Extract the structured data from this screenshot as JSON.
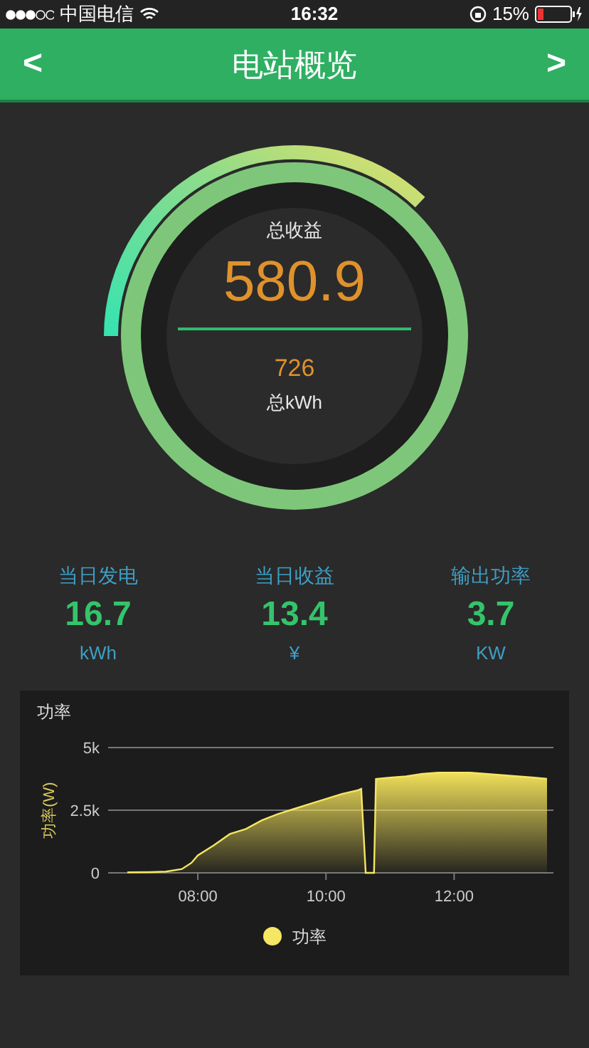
{
  "status_bar": {
    "carrier": "中国电信",
    "time": "16:32",
    "battery": "15%"
  },
  "header": {
    "back": "<",
    "title": "电站概览",
    "forward": ">"
  },
  "gauge": {
    "label": "总收益",
    "value": "580.9",
    "sub_value": "726",
    "sub_label": "总kWh"
  },
  "stats": [
    {
      "label": "当日发电",
      "value": "16.7",
      "unit": "kWh"
    },
    {
      "label": "当日收益",
      "value": "13.4",
      "unit": "¥"
    },
    {
      "label": "输出功率",
      "value": "3.7",
      "unit": "KW"
    }
  ],
  "power_chart": {
    "title": "功率",
    "chart_data": {
      "type": "area",
      "ylabel": "功率(W)",
      "x": [
        6.9,
        7.25,
        7.5,
        7.75,
        7.9,
        8.0,
        8.25,
        8.5,
        8.75,
        9.0,
        9.25,
        9.5,
        9.75,
        10.0,
        10.25,
        10.5,
        10.55,
        10.62,
        10.75,
        10.78,
        11.0,
        11.25,
        11.5,
        11.75,
        12.0,
        12.25,
        12.5,
        12.75,
        13.0,
        13.25,
        13.45
      ],
      "series": [
        {
          "name": "功率",
          "color": "#f5e663",
          "values": [
            20,
            30,
            50,
            150,
            400,
            700,
            1100,
            1550,
            1750,
            2100,
            2350,
            2550,
            2750,
            2950,
            3150,
            3300,
            3350,
            0,
            0,
            3750,
            3800,
            3850,
            3950,
            4000,
            4000,
            4000,
            3950,
            3900,
            3850,
            3800,
            3750
          ]
        }
      ],
      "xlim": [
        6.6,
        13.55
      ],
      "ylim": [
        0,
        5000
      ],
      "xticks": [
        {
          "value": 8,
          "label": "08:00"
        },
        {
          "value": 10,
          "label": "10:00"
        },
        {
          "value": 12,
          "label": "12:00"
        }
      ],
      "yticks": [
        {
          "value": 0,
          "label": "0"
        },
        {
          "value": 2500,
          "label": "2.5k"
        },
        {
          "value": 5000,
          "label": "5k"
        }
      ]
    }
  }
}
